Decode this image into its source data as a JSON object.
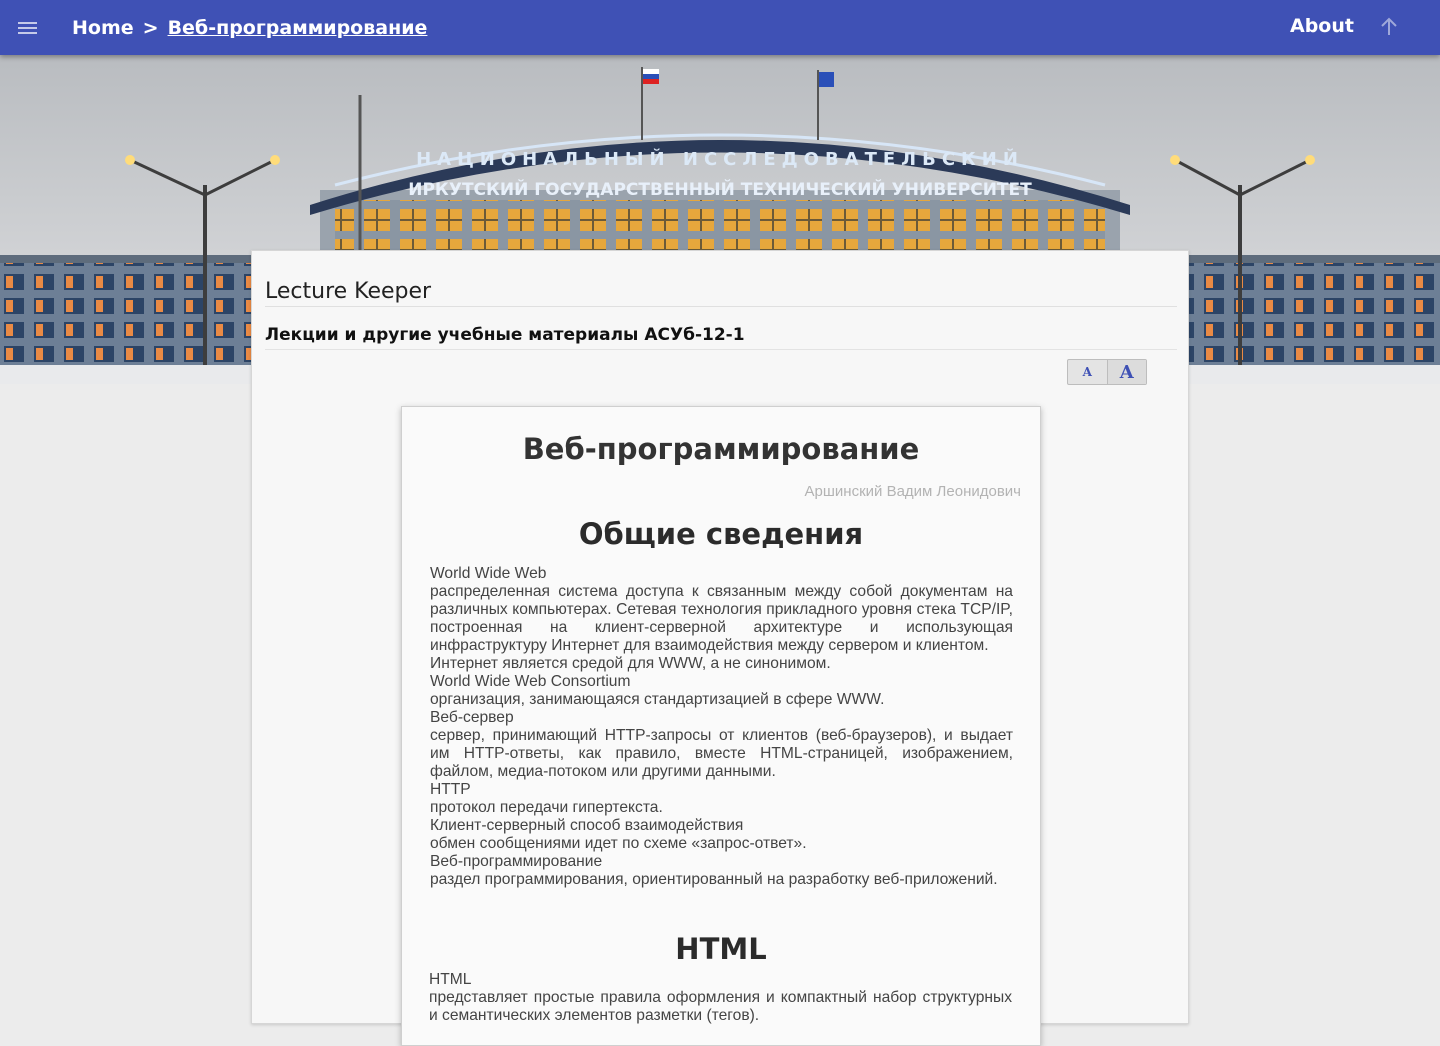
{
  "appbar": {
    "breadcrumb": {
      "home": "Home",
      "separator": ">",
      "current": "Веб-программирование"
    },
    "about_label": "About"
  },
  "header": {
    "site_title": "Lecture Keeper",
    "site_subtitle": "Лекции и другие учебные материалы АСУб-12-1",
    "font_small": "A",
    "font_large": "A"
  },
  "document": {
    "title": "Веб-программирование",
    "author": "Аршинский Вадим Леонидович",
    "sections": [
      {
        "title": "Общие сведения",
        "definitions": [
          {
            "term": "World Wide Web",
            "desc": "распределенная система доступа к связанным между собой документам на различных компьютерах. Сетевая технология прикладного уровня стека TCP/IP, построенная на клиент-серверной архитектуре и использующая инфраструктуру Интернет для взаимодействия между сервером и клиентом.",
            "note": "Интернет является средой для WWW, а не синонимом."
          },
          {
            "term": "World Wide Web Consortium",
            "desc": "организация, занимающаяся стандартизацией в сфере WWW."
          },
          {
            "term": "Веб-сервер",
            "desc": "сервер, принимающий HTTP-запросы от клиентов (веб-браузеров), и выдает им HTTP-ответы, как правило, вместе HTML-страницей, изображением, файлом, медиа-потоком или другими данными."
          },
          {
            "term": "HTTP",
            "desc": "протокол передачи гипертекста."
          },
          {
            "term": "Клиент-серверный способ взаимодействия",
            "desc": "обмен сообщениями идет по схеме «запрос-ответ»."
          },
          {
            "term": "Веб-программирование",
            "desc": "раздел программирования, ориентированный на разработку веб-приложений."
          }
        ]
      },
      {
        "title": "HTML",
        "definitions": [
          {
            "term": "HTML",
            "desc": "представляет простые правила оформления и компактный набор структурных и семантических элементов разметки (тегов)."
          }
        ]
      }
    ]
  },
  "hero_sign": {
    "top_line": "НАЦИОНАЛЬНЫЙ ИССЛЕДОВАТЕЛЬСКИЙ",
    "bottom_line": "ИРКУТСКИЙ ГОСУДАРСТВЕННЫЙ ТЕХНИЧЕСКИЙ УНИВЕРСИТЕТ"
  },
  "colors": {
    "appbar": "#3f51b5",
    "accent": "#3f51b5",
    "page_background": "#ececec",
    "card_background": "#f7f7f7",
    "author_text": "#b3b3b3"
  },
  "icons": {
    "menu": "menu-icon",
    "scroll_top": "arrow-up-icon"
  }
}
